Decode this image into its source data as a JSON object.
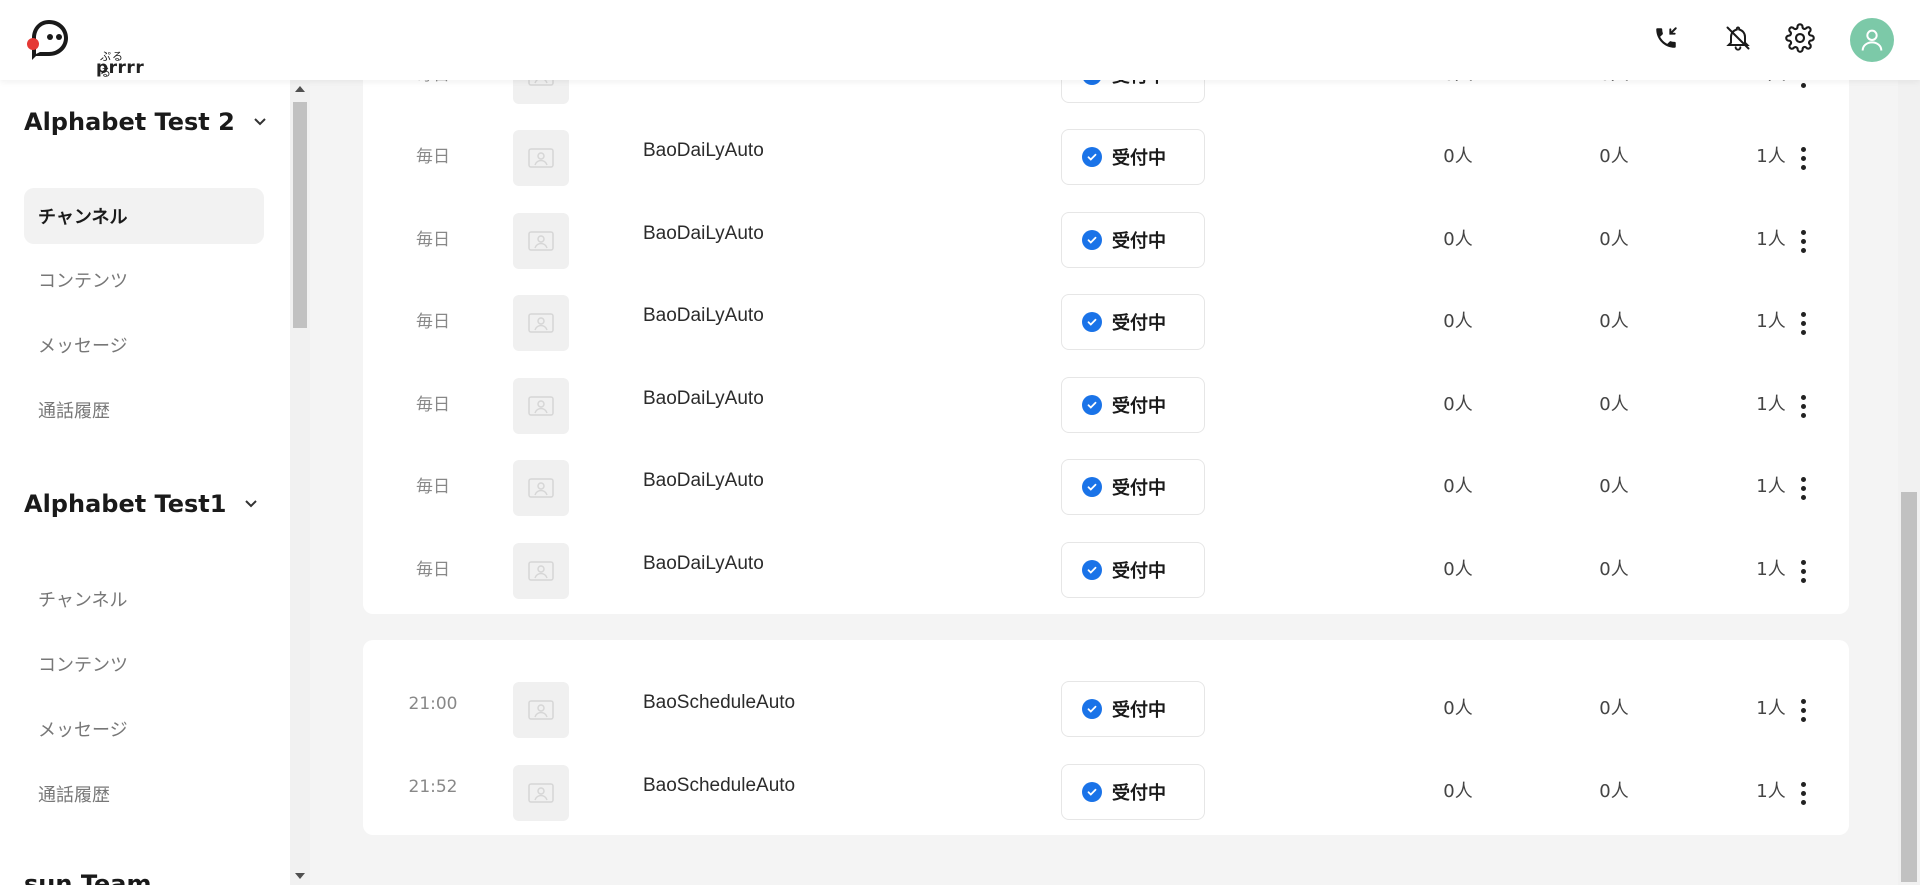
{
  "header": {
    "logo_sub": "ぷるる",
    "logo_main": "prrrr",
    "icons": [
      "phone-incoming-icon",
      "bell-off-icon",
      "gear-icon",
      "user-avatar-icon"
    ],
    "avatar_color": "#7cc9a8"
  },
  "sidebar": {
    "teams": [
      {
        "name": "Alphabet Test 2",
        "items": [
          "チャンネル",
          "コンテンツ",
          "メッセージ",
          "通話履歴"
        ],
        "active_index": 0
      },
      {
        "name": "Alphabet Test1",
        "items": [
          "チャンネル",
          "コンテンツ",
          "メッセージ",
          "通話履歴"
        ]
      },
      {
        "name": "sun Team"
      }
    ]
  },
  "lists": {
    "daily": [
      {
        "time": "毎日",
        "name": "BaoDaiLyAuto",
        "status": "受付中",
        "c1": "0人",
        "c2": "0人",
        "c3": "1人"
      },
      {
        "time": "毎日",
        "name": "BaoDaiLyAuto",
        "status": "受付中",
        "c1": "0人",
        "c2": "0人",
        "c3": "1人"
      },
      {
        "time": "毎日",
        "name": "BaoDaiLyAuto",
        "status": "受付中",
        "c1": "0人",
        "c2": "0人",
        "c3": "1人"
      },
      {
        "time": "毎日",
        "name": "BaoDaiLyAuto",
        "status": "受付中",
        "c1": "0人",
        "c2": "0人",
        "c3": "1人"
      },
      {
        "time": "毎日",
        "name": "BaoDaiLyAuto",
        "status": "受付中",
        "c1": "0人",
        "c2": "0人",
        "c3": "1人"
      },
      {
        "time": "毎日",
        "name": "BaoDaiLyAuto",
        "status": "受付中",
        "c1": "0人",
        "c2": "0人",
        "c3": "1人"
      },
      {
        "time": "毎日",
        "name": "BaoDaiLyAuto",
        "status": "受付中",
        "c1": "0人",
        "c2": "0人",
        "c3": "1人"
      }
    ],
    "schedule": [
      {
        "time": "21:00",
        "name": "BaoScheduleAuto",
        "status": "受付中",
        "c1": "0人",
        "c2": "0人",
        "c3": "1人"
      },
      {
        "time": "21:52",
        "name": "BaoScheduleAuto",
        "status": "受付中",
        "c1": "0人",
        "c2": "0人",
        "c3": "1人"
      }
    ]
  },
  "colors": {
    "status_check": "#1a73e8",
    "active_nav_bg": "#f2f2f2"
  }
}
